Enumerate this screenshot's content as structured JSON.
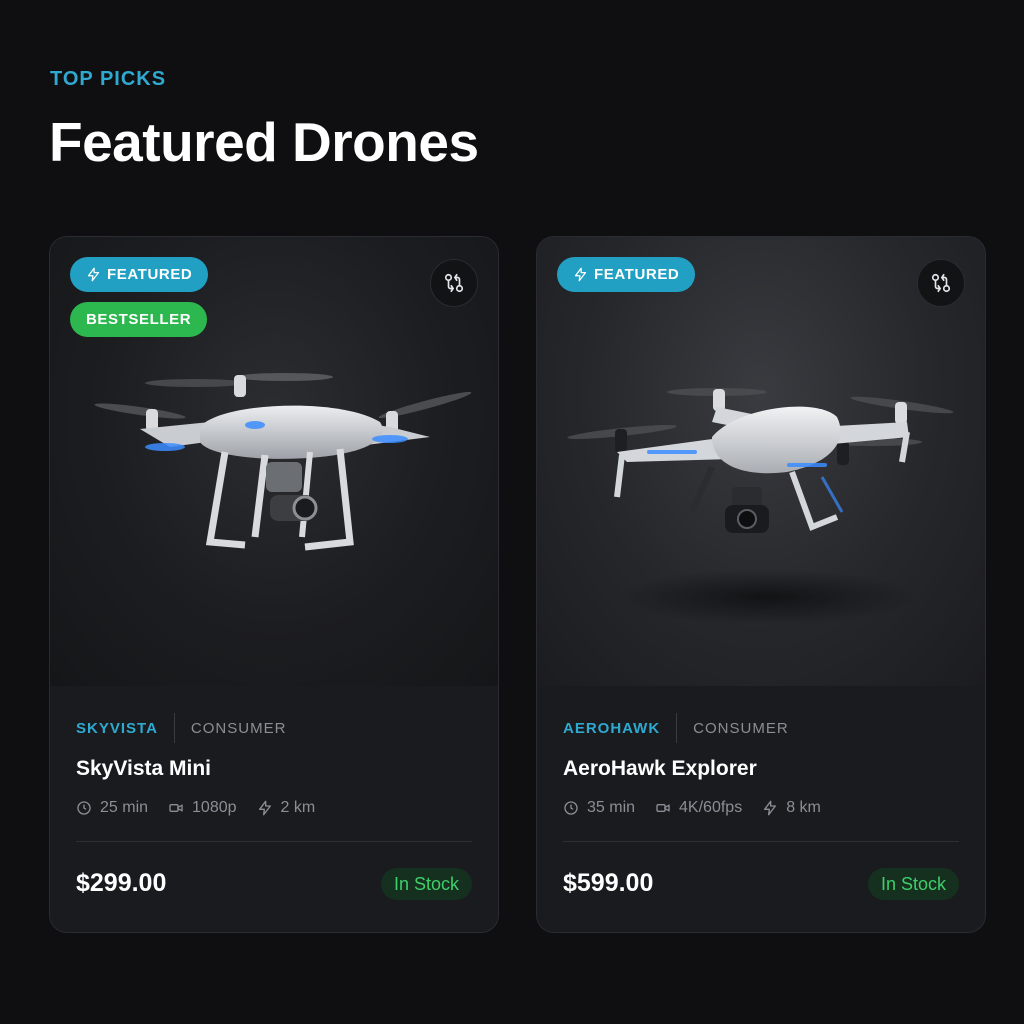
{
  "header": {
    "eyebrow": "TOP PICKS",
    "title": "Featured Drones"
  },
  "colors": {
    "accent": "#2fa9d0",
    "featured_badge": "#22a0c3",
    "bestseller_badge": "#2cb84e",
    "in_stock_text": "#3fcf6a",
    "background": "#0f0f11",
    "card": "#1a1b1f"
  },
  "products": [
    {
      "badges": [
        "FEATURED",
        "BESTSELLER"
      ],
      "compare_icon": "compare-arrows-icon",
      "brand": "SKYVISTA",
      "category": "CONSUMER",
      "name": "SkyVista Mini",
      "specs": [
        {
          "icon": "clock-icon",
          "value": "25 min"
        },
        {
          "icon": "video-camera-icon",
          "value": "1080p"
        },
        {
          "icon": "lightning-icon",
          "value": "2 km"
        }
      ],
      "price": "$299.00",
      "stock": "In Stock"
    },
    {
      "badges": [
        "FEATURED"
      ],
      "compare_icon": "compare-arrows-icon",
      "brand": "AEROHAWK",
      "category": "CONSUMER",
      "name": "AeroHawk Explorer",
      "specs": [
        {
          "icon": "clock-icon",
          "value": "35 min"
        },
        {
          "icon": "video-camera-icon",
          "value": "4K/60fps"
        },
        {
          "icon": "lightning-icon",
          "value": "8 km"
        }
      ],
      "price": "$599.00",
      "stock": "In Stock"
    }
  ]
}
